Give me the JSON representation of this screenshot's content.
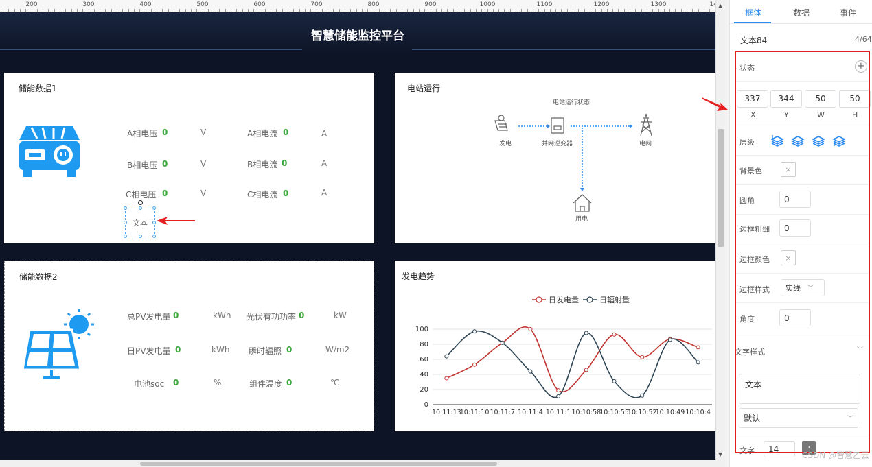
{
  "ruler": {
    "ticks": [
      "200",
      "300",
      "400",
      "500",
      "600",
      "700",
      "800",
      "900",
      "1000",
      "1100",
      "1200",
      "1300",
      "140"
    ]
  },
  "canvas": {
    "title": "智慧储能监控平台",
    "panel1": {
      "title": "储能数据1",
      "rows": [
        {
          "label_a": "A相电压",
          "val_a": "0",
          "unit_a": "V",
          "label_b": "A相电流",
          "val_b": "0",
          "unit_b": "A"
        },
        {
          "label_a": "B相电压",
          "val_a": "0",
          "unit_a": "V",
          "label_b": "B相电流",
          "val_b": "0",
          "unit_b": "A"
        },
        {
          "label_a": "C相电压",
          "val_a": "0",
          "unit_a": "V",
          "label_b": "C相电流",
          "val_b": "0",
          "unit_b": "A"
        }
      ],
      "selected_text": "文本"
    },
    "panel2": {
      "title": "电站运行",
      "diagram_title": "电站运行状态",
      "nodes": {
        "gen": "发电",
        "inverter": "并网逆变器",
        "grid": "电网",
        "use": "用电"
      }
    },
    "panel3": {
      "title": "储能数据2",
      "rows": [
        {
          "label_a": "总PV发电量",
          "val_a": "0",
          "unit_a": "kWh",
          "label_b": "光伏有功功率",
          "val_b": "0",
          "unit_b": "kW"
        },
        {
          "label_a": "日PV发电量",
          "val_a": "0",
          "unit_a": "kWh",
          "label_b": "瞬时辐照",
          "val_b": "0",
          "unit_b": "W/m2"
        },
        {
          "label_a": "电池soc",
          "val_a": "0",
          "unit_a": "%",
          "label_b": "组件温度",
          "val_b": "0",
          "unit_b": "℃"
        }
      ]
    },
    "panel4": {
      "title": "发电趋势"
    }
  },
  "chart_data": {
    "type": "line",
    "categories": [
      "10:11:13",
      "10:11:10",
      "10:11:7",
      "10:11:4",
      "10:11:1",
      "10:10:58",
      "10:10:55",
      "10:10:52",
      "10:10:49",
      "10:10:4"
    ],
    "series": [
      {
        "name": "日发电量",
        "color": "#c23531",
        "values": [
          35,
          53,
          82,
          100,
          19,
          46,
          93,
          63,
          87,
          76
        ]
      },
      {
        "name": "日辐射量",
        "color": "#2f4554",
        "values": [
          64,
          97,
          82,
          44,
          11,
          95,
          31,
          12,
          86,
          56
        ]
      }
    ],
    "ylim": [
      0,
      100
    ],
    "yticks": [
      "0",
      "20",
      "40",
      "60",
      "80",
      "100"
    ],
    "legend": "top-center",
    "grid": true
  },
  "right_panel": {
    "tabs": [
      "框体",
      "数据",
      "事件"
    ],
    "active_tab": "框体",
    "component_name": "文本84",
    "page_count": "4/64",
    "state_label": "状态",
    "pos": {
      "x": "337",
      "y": "344",
      "w": "50",
      "h": "50",
      "x_lbl": "X",
      "y_lbl": "Y",
      "w_lbl": "W",
      "h_lbl": "H"
    },
    "layer_label": "层级",
    "bg_label": "背景色",
    "radius_label": "圆角",
    "radius_val": "0",
    "border_width_label": "边框粗细",
    "border_width_val": "0",
    "border_color_label": "边框颜色",
    "border_style_label": "边框样式",
    "border_style_val": "实线",
    "angle_label": "角度",
    "angle_val": "0",
    "text_style_label": "文字样式",
    "text_content": "文本",
    "font_select": "默认",
    "font_size_label": "文字",
    "font_size_val": "14"
  },
  "watermark": "CSDN @智慧乙云"
}
